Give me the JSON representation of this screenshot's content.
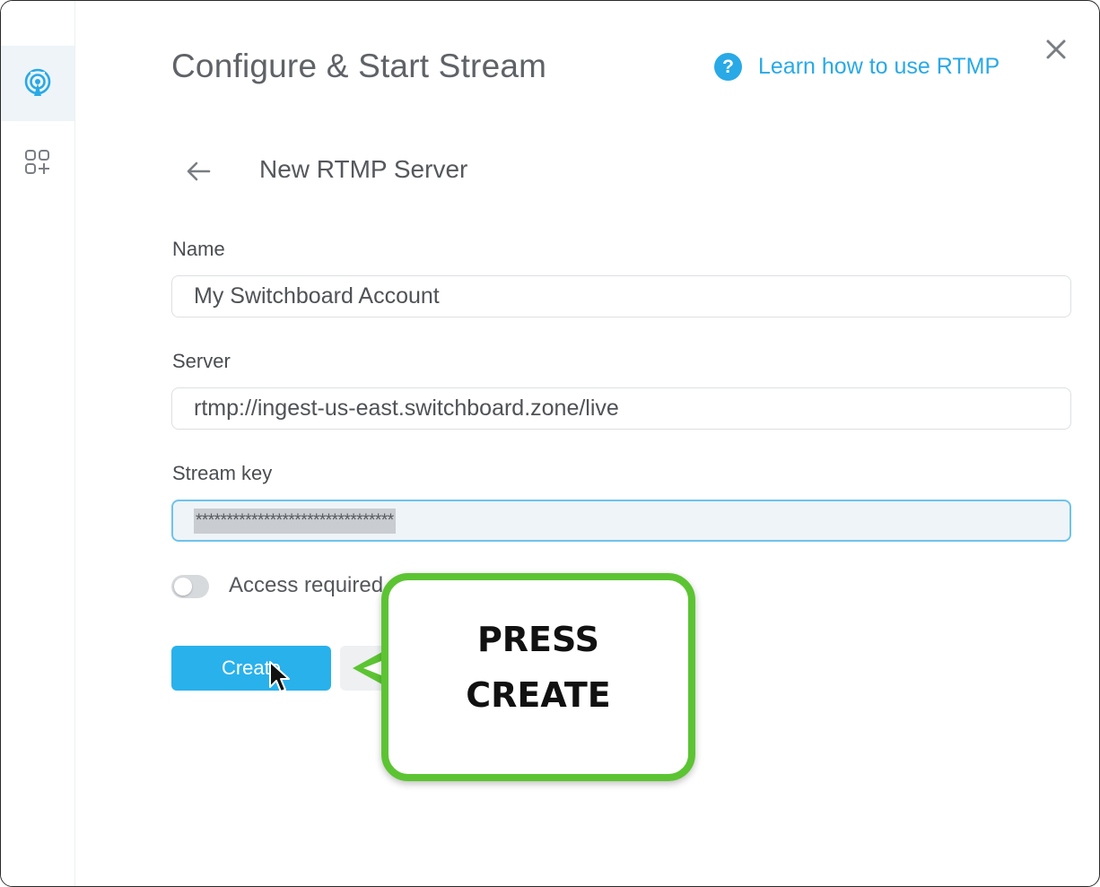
{
  "dialog": {
    "title": "Configure & Start Stream",
    "help_link": "Learn how to use RTMP",
    "help_icon": "?",
    "subtitle": "New RTMP Server"
  },
  "sidebar": {
    "items": [
      {
        "icon": "broadcast-icon",
        "active": true
      },
      {
        "icon": "add-apps-icon",
        "active": false
      }
    ]
  },
  "form": {
    "name_label": "Name",
    "name_value": "My Switchboard Account",
    "server_label": "Server",
    "server_value": "rtmp://ingest-us-east.switchboard.zone/live",
    "stream_key_label": "Stream key",
    "stream_key_masked": "********************************",
    "access_required_label": "Access required",
    "access_required": false,
    "create_label": "Create"
  },
  "callout": {
    "text": "PRESS\nCREATE"
  },
  "colors": {
    "accent": "#29b1ec",
    "callout_border": "#5cc433"
  }
}
